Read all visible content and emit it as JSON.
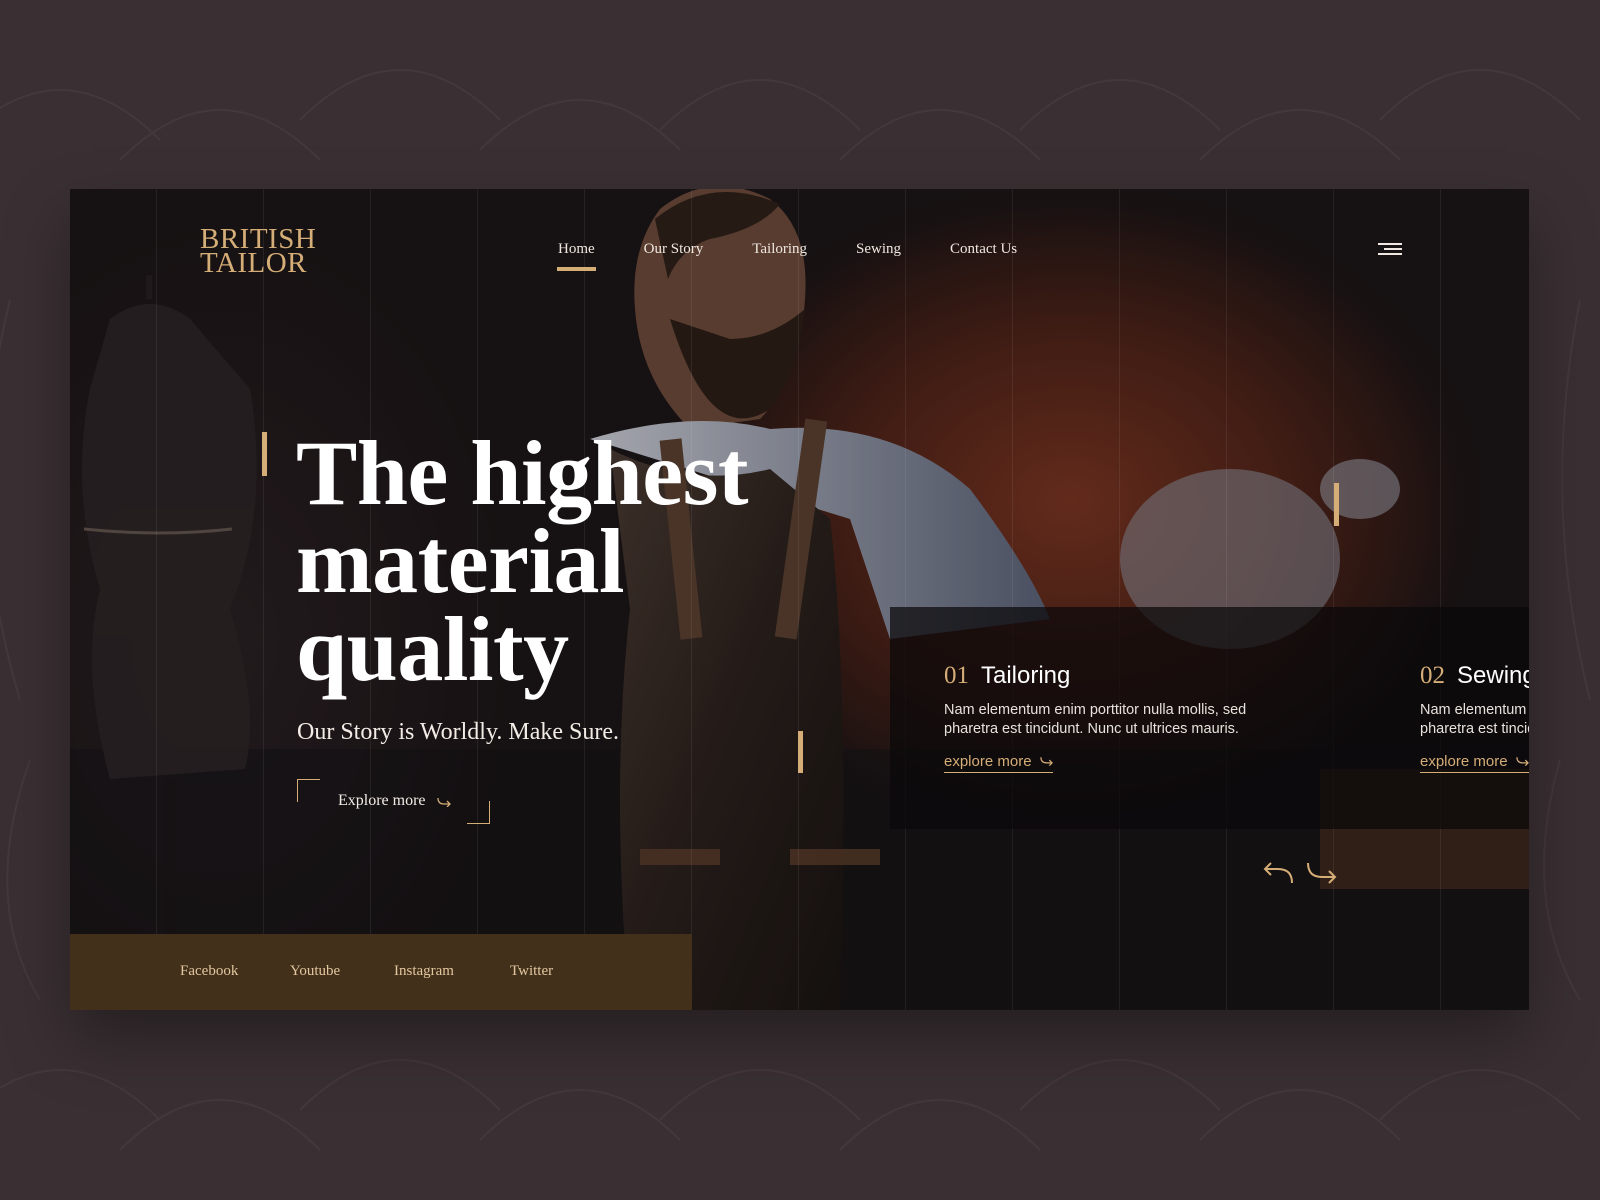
{
  "brand": {
    "logo_line1": "BRITISH",
    "logo_line2": "TAILOR"
  },
  "nav": {
    "items": [
      "Home",
      "Our Story",
      "Tailoring",
      "Sewing",
      "Contact Us"
    ],
    "active": "Home"
  },
  "hero": {
    "headline_line1": "The highest",
    "headline_line2": "material",
    "headline_line3": "quality",
    "subline": "Our Story is Worldly. Make Sure.",
    "cta_label": "Explore more"
  },
  "services": [
    {
      "number": "01",
      "title": "Tailoring",
      "description": "Nam elementum enim porttitor nulla mollis, sed pharetra est tincidunt. Nunc ut ultrices mauris.",
      "link": "explore more"
    },
    {
      "number": "02",
      "title": "Sewing",
      "description": "Nam elementum enim porttitor nulla mollis, sed pharetra est tincidunt. Nunc ut ultrices mauris.",
      "link": "explore more"
    }
  ],
  "social": [
    "Facebook",
    "Youtube",
    "Instagram",
    "Twitter"
  ],
  "icons": {
    "menu": "hamburger-menu-icon",
    "prev": "arrow-prev-icon",
    "next": "arrow-next-icon",
    "link_arrow": "curved-arrow-icon"
  },
  "colors": {
    "accent": "#d5ad77",
    "page_bg": "#3a3034",
    "social_bar": "#43301a",
    "card_panel": "#0a080a"
  }
}
